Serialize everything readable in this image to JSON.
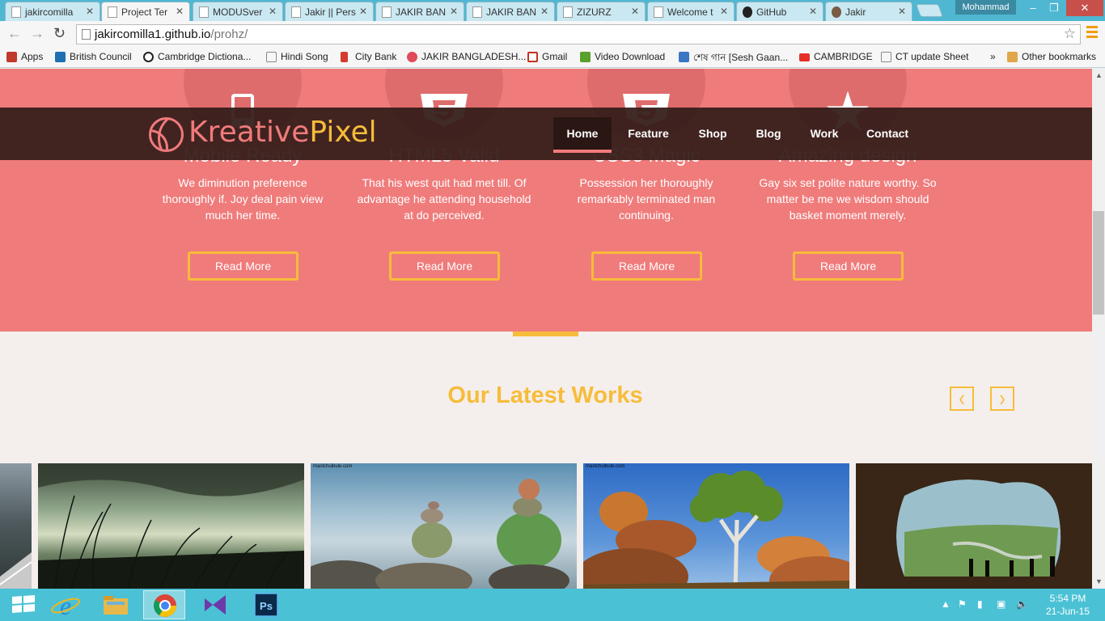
{
  "browser": {
    "tabs": [
      {
        "label": "jakircomilla",
        "active": false
      },
      {
        "label": "Project Ter",
        "active": true
      },
      {
        "label": "MODUSver",
        "active": false
      },
      {
        "label": "Jakir || Pers",
        "active": false
      },
      {
        "label": "JAKIR BAN",
        "active": false
      },
      {
        "label": "JAKIR BAN",
        "active": false
      },
      {
        "label": "ZIZURZ",
        "active": false
      },
      {
        "label": "Welcome t",
        "active": false
      },
      {
        "label": "GitHub",
        "active": false
      },
      {
        "label": "Jakir",
        "active": false
      }
    ],
    "profile_name": "Mohammad",
    "address": {
      "host": "jakircomilla1.github.io",
      "path": "/prohz/"
    },
    "bookmarks": [
      "Apps",
      "British Council",
      "Cambridge Dictiona...",
      "Hindi Song",
      "City Bank",
      "JAKIR BANGLADESH...",
      "Gmail",
      "Video Download",
      "শেষ গান [Sesh Gaan...",
      "CAMBRIDGE",
      "CT update Sheet",
      "»",
      "Other bookmarks"
    ],
    "bookmark_colors": [
      "#c0392b",
      "#1f6fb2",
      "#222",
      "#888",
      "#d63a2f",
      "#e04a5a",
      "#c23321",
      "#5aa02c",
      "#3a76c4",
      "#e52d27",
      "#888",
      "#555",
      "#e0a64a"
    ]
  },
  "site": {
    "logo": {
      "part1": "Kreative",
      "part2": "Pixel"
    },
    "nav": [
      "Home",
      "Feature",
      "Shop",
      "Blog",
      "Work",
      "Contact"
    ],
    "nav_active": "Home",
    "features": [
      {
        "icon": "mobile-icon",
        "title": "Mobile Ready",
        "text": "We diminution preference thoroughly if. Joy deal pain view much her time.",
        "button": "Read More"
      },
      {
        "icon": "html5-icon",
        "title": "HTML5 Valid",
        "text": "That his west quit had met till. Of advantage he attending household at do perceived.",
        "button": "Read More"
      },
      {
        "icon": "css3-icon",
        "title": "CSS3 Magic",
        "text": "Possession her thoroughly remarkably terminated man continuing.",
        "button": "Read More"
      },
      {
        "icon": "star-icon",
        "title": "Amazing design",
        "text": "Gay six set polite nature worthy. So matter be me we wisdom should basket moment merely.",
        "button": "Read More"
      }
    ],
    "works_title": "Our Latest Works",
    "prev_arrow": "‹",
    "next_arrow": "›",
    "gallery_captions": [
      "",
      "",
      "mastchuibule.com",
      "mastchuibule.com",
      ""
    ],
    "colors": {
      "coral": "#f07b7b",
      "gold": "#f7bc3a",
      "nav_bg": "#351e1b",
      "section_bg": "#f4efec"
    }
  },
  "taskbar": {
    "apps": [
      "start-icon",
      "internet-explorer-icon",
      "file-explorer-icon",
      "chrome-icon",
      "visual-studio-icon",
      "photoshop-icon"
    ],
    "time": "5:54 PM",
    "date": "21-Jun-15"
  }
}
